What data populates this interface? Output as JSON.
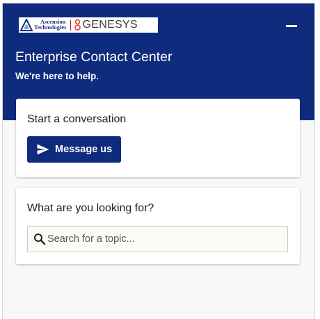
{
  "header": {
    "logo": {
      "ascension_line1": "Ascension",
      "ascension_line2": "Technologies",
      "genesys": "GENESYS"
    },
    "minimize_icon": "minimize-icon",
    "title": "Enterprise Contact Center",
    "subtitle": "We're here to help."
  },
  "conversation_card": {
    "heading": "Start a conversation",
    "button_label": "Message us",
    "button_icon": "send-icon"
  },
  "search_card": {
    "heading": "What are you looking for?",
    "placeholder": "Search for a topic...",
    "value": "",
    "icon": "search-icon"
  },
  "colors": {
    "brand_navy": "#0f2b7e",
    "genesys_red": "#b81f1f",
    "card_bg": "#ffffff",
    "panel_bg": "#f8f8f8"
  }
}
